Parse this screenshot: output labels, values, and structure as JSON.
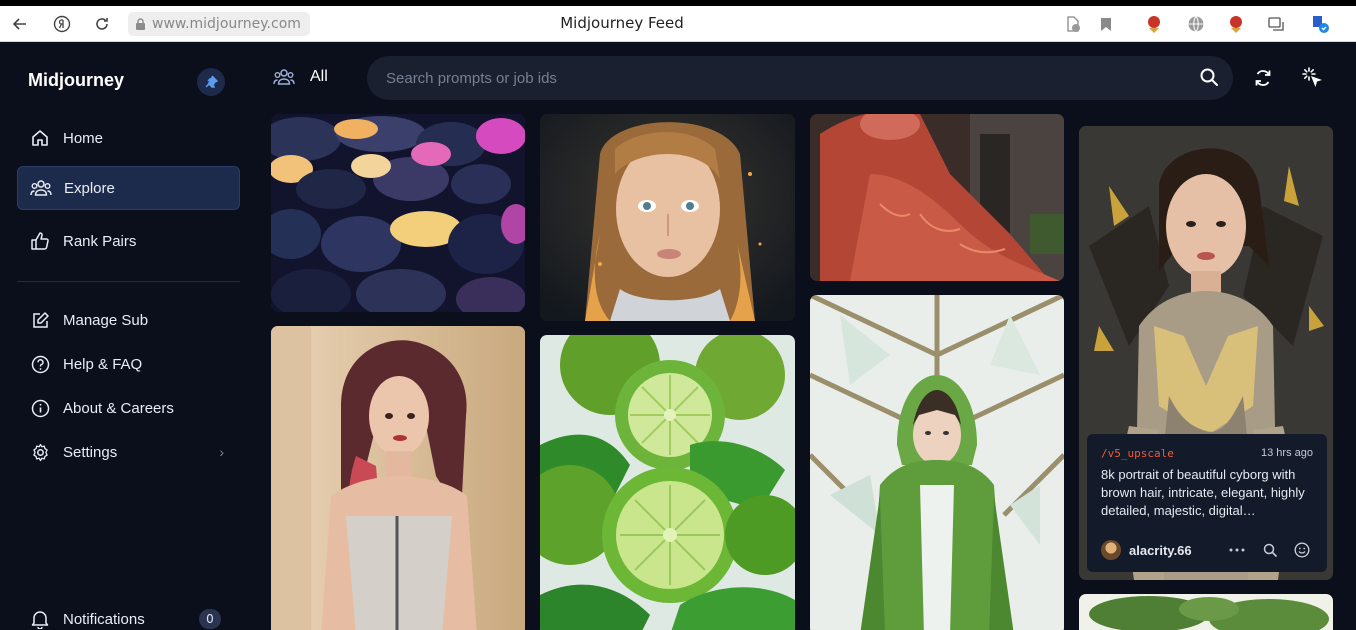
{
  "browser": {
    "url": "www.midjourney.com",
    "tab_title": "Midjourney Feed"
  },
  "sidebar": {
    "brand": "Midjourney",
    "items": [
      {
        "label": "Home",
        "icon": "home-icon"
      },
      {
        "label": "Explore",
        "icon": "people-icon",
        "active": true
      },
      {
        "label": "Rank Pairs",
        "icon": "thumbs-up-icon"
      },
      {
        "label": "Manage Sub",
        "icon": "edit-icon"
      },
      {
        "label": "Help & FAQ",
        "icon": "help-icon"
      },
      {
        "label": "About & Careers",
        "icon": "info-icon"
      },
      {
        "label": "Settings",
        "icon": "gear-icon"
      }
    ],
    "notifications": {
      "label": "Notifications",
      "count": "0"
    }
  },
  "toolbar": {
    "filter_label": "All",
    "search_placeholder": "Search prompts or job ids"
  },
  "featured_card": {
    "command": "/v5_upscale",
    "time": "13 hrs ago",
    "prompt": "8k portrait of beautiful cyborg with brown hair, intricate, elegant, highly detailed, majestic, digital…",
    "user": "alacrity.66"
  },
  "colors": {
    "background": "#0b0f1c",
    "active_nav": "#1c2b4b",
    "search_bg": "#1a2030",
    "command_accent": "#f05a3a"
  }
}
